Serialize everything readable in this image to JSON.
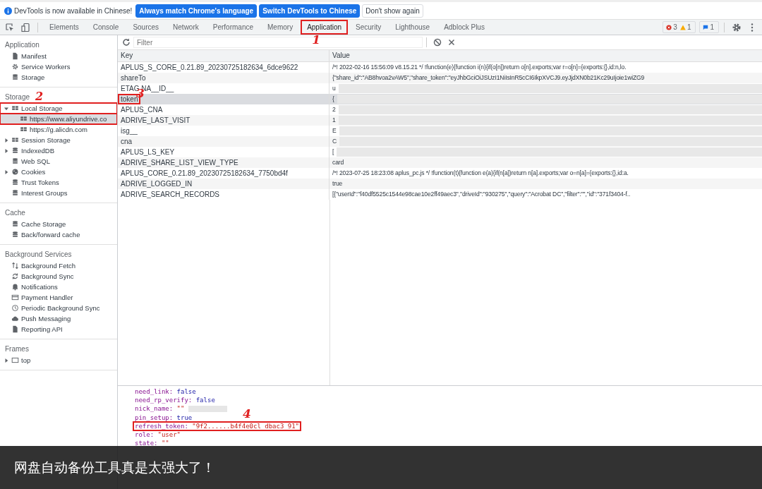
{
  "infobar": {
    "message": "DevTools is now available in Chinese!",
    "buttons": [
      {
        "label": "Always match Chrome's language",
        "kind": "primary"
      },
      {
        "label": "Switch DevTools to Chinese",
        "kind": "primary"
      },
      {
        "label": "Don't show again",
        "kind": "plain"
      }
    ]
  },
  "tabs": [
    {
      "label": "Elements",
      "selected": false
    },
    {
      "label": "Console",
      "selected": false
    },
    {
      "label": "Sources",
      "selected": false
    },
    {
      "label": "Network",
      "selected": false
    },
    {
      "label": "Performance",
      "selected": false
    },
    {
      "label": "Memory",
      "selected": false
    },
    {
      "label": "Application",
      "selected": true,
      "highlighted": true,
      "annotation": "1"
    },
    {
      "label": "Security",
      "selected": false
    },
    {
      "label": "Lighthouse",
      "selected": false
    },
    {
      "label": "Adblock Plus",
      "selected": false
    }
  ],
  "issues": {
    "errors": "3",
    "warnings": "1",
    "messages": "1"
  },
  "sidebar": [
    {
      "title": "Application",
      "items": [
        {
          "label": "Manifest",
          "kind": "file",
          "selected": false
        },
        {
          "label": "Service Workers",
          "kind": "gear",
          "selected": false
        },
        {
          "label": "Storage",
          "kind": "db",
          "selected": false
        }
      ]
    },
    {
      "title": "Storage",
      "annotation": "2",
      "items": [
        {
          "label": "Local Storage",
          "kind": "grid",
          "selected": false,
          "expanded": true,
          "highlighted": true,
          "children": [
            {
              "label": "https://www.aliyundrive.co",
              "kind": "grid",
              "selected": true,
              "highlighted": true
            },
            {
              "label": "https://g.alicdn.com",
              "kind": "grid",
              "selected": false
            }
          ]
        },
        {
          "label": "Session Storage",
          "kind": "grid",
          "selected": false,
          "expanded": false
        },
        {
          "label": "IndexedDB",
          "kind": "db",
          "selected": false,
          "expanded": false
        },
        {
          "label": "Web SQL",
          "kind": "db",
          "selected": false
        },
        {
          "label": "Cookies",
          "kind": "cookie",
          "selected": false,
          "expanded": false
        },
        {
          "label": "Trust Tokens",
          "kind": "db",
          "selected": false
        },
        {
          "label": "Interest Groups",
          "kind": "db",
          "selected": false
        }
      ]
    },
    {
      "title": "Cache",
      "items": [
        {
          "label": "Cache Storage",
          "kind": "db",
          "selected": false
        },
        {
          "label": "Back/forward cache",
          "kind": "db",
          "selected": false
        }
      ]
    },
    {
      "title": "Background Services",
      "items": [
        {
          "label": "Background Fetch",
          "kind": "arrows",
          "selected": false
        },
        {
          "label": "Background Sync",
          "kind": "sync",
          "selected": false
        },
        {
          "label": "Notifications",
          "kind": "bell",
          "selected": false
        },
        {
          "label": "Payment Handler",
          "kind": "card",
          "selected": false
        },
        {
          "label": "Periodic Background Sync",
          "kind": "clock",
          "selected": false
        },
        {
          "label": "Push Messaging",
          "kind": "cloud",
          "selected": false
        },
        {
          "label": "Reporting API",
          "kind": "file",
          "selected": false
        }
      ]
    },
    {
      "title": "Frames",
      "items": [
        {
          "label": "top",
          "kind": "frame",
          "selected": false,
          "expanded": false
        }
      ]
    }
  ],
  "filter": {
    "placeholder": "Filter"
  },
  "table": {
    "columns": [
      "Key",
      "Value"
    ],
    "rows": [
      {
        "key": "APLUS_S_CORE_0.21.89_20230725182634_6dce9622",
        "value": "/*! 2022-02-16 15:56:09 v8.15.21 */ !function(e){function i(n){if(o[n])return o[n].exports;var r=o[n]={exports:{},id:n,lo.",
        "selected": false,
        "blurred": false
      },
      {
        "key": "shareTo",
        "value": "{\"share_id\":\"AB8hvoa2vAW5\",\"share_token\":\"eyJhbGciOiJSUzI1NiIsInR5cCI6IkpXVCJ9.eyJjdXN0b21Kc29uIjoie1wiZG9",
        "selected": false,
        "blurred": false
      },
      {
        "key": "ETAG NA__ID__",
        "value": "u",
        "selected": false,
        "blurred": true
      },
      {
        "key": "token",
        "value": "{",
        "selected": true,
        "blurred": true,
        "highlighted": true,
        "annotation": "3"
      },
      {
        "key": "APLUS_CNA",
        "value": "2",
        "selected": false,
        "blurred": true
      },
      {
        "key": "ADRIVE_LAST_VISIT",
        "value": "1",
        "selected": false,
        "blurred": true
      },
      {
        "key": "isg__",
        "value": "E",
        "selected": false,
        "blurred": true
      },
      {
        "key": "cna",
        "value": "C",
        "selected": false,
        "blurred": true
      },
      {
        "key": "APLUS_LS_KEY",
        "value": "[",
        "selected": false,
        "blurred": true
      },
      {
        "key": "ADRIVE_SHARE_LIST_VIEW_TYPE",
        "value": "card",
        "selected": false,
        "blurred": false
      },
      {
        "key": "APLUS_CORE_0.21.89_20230725182634_7750bd4f",
        "value": "/*! 2023-07-25 18:23:08 aplus_pc.js */ !function(t){function e(a){if(n[a])return n[a].exports;var o=n[a]={exports:{},id:a.",
        "selected": false,
        "blurred": false
      },
      {
        "key": "ADRIVE_LOGGED_IN",
        "value": "true",
        "selected": false,
        "blurred": false
      },
      {
        "key": "ADRIVE_SEARCH_RECORDS",
        "value": "[{\"userId\":\"f40df5525c1544e98cae10e2ff49aec3\",\"driveId\":\"930275\",\"query\":\"Acrobat DC\",\"filter\":\"\",\"id\":\"371f3404-f..",
        "selected": false,
        "blurred": false
      }
    ]
  },
  "preview": [
    {
      "key": "need_link:",
      "value": "false",
      "kind": "bool"
    },
    {
      "key": "need_rp_verify:",
      "value": "false",
      "kind": "bool"
    },
    {
      "key": "nick_name:",
      "value": "\"\"",
      "kind": "string",
      "blurred": true
    },
    {
      "key": "pin_setup:",
      "value": "true",
      "kind": "bool"
    },
    {
      "key": "refresh_token:",
      "value": "\"9f2......b4f4e0cl  dbac3   91\"",
      "kind": "string",
      "highlighted": true,
      "annotation": "4"
    },
    {
      "key": "role:",
      "value": "\"user\"",
      "kind": "string"
    },
    {
      "key": "state:",
      "value": "\"\"",
      "kind": "string"
    }
  ],
  "caption": "网盘自动备份工具真是太强大了！"
}
